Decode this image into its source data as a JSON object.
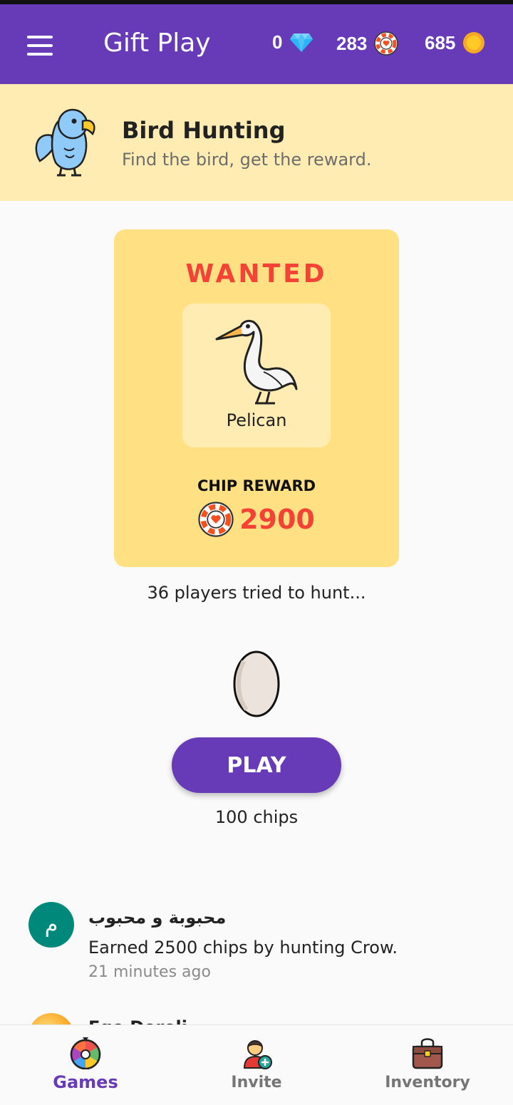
{
  "app": {
    "title": "Gift Play",
    "accent_color": "#673ab7",
    "menu_icon": "hamburger-menu-icon"
  },
  "balances": {
    "gems": {
      "value": "0",
      "icon": "diamond-icon"
    },
    "chips": {
      "value": "283",
      "icon": "chip-icon"
    },
    "coins": {
      "value": "685",
      "icon": "coin-icon"
    }
  },
  "game": {
    "title": "Bird Hunting",
    "subtitle": "Find the bird, get the reward.",
    "icon": "parrot-icon"
  },
  "wanted": {
    "label": "WANTED",
    "bird_name": "Pelican",
    "bird_icon": "pelican-icon",
    "reward_label": "CHIP REWARD",
    "reward_value": "2900"
  },
  "hunt": {
    "players_tried": "36 players tried to hunt...",
    "play_label": "PLAY",
    "play_cost": "100 chips"
  },
  "feed": [
    {
      "avatar_letter": "م",
      "name": "محبوبة و محبوب",
      "message": "Earned 2500 chips by hunting Crow.",
      "time": "21 minutes ago"
    },
    {
      "name": "Ege Dereli"
    }
  ],
  "bottom_nav": [
    {
      "label": "Games",
      "icon": "wheel-icon",
      "active": true
    },
    {
      "label": "Invite",
      "icon": "invite-user-icon",
      "active": false
    },
    {
      "label": "Inventory",
      "icon": "bag-icon",
      "active": false
    }
  ]
}
